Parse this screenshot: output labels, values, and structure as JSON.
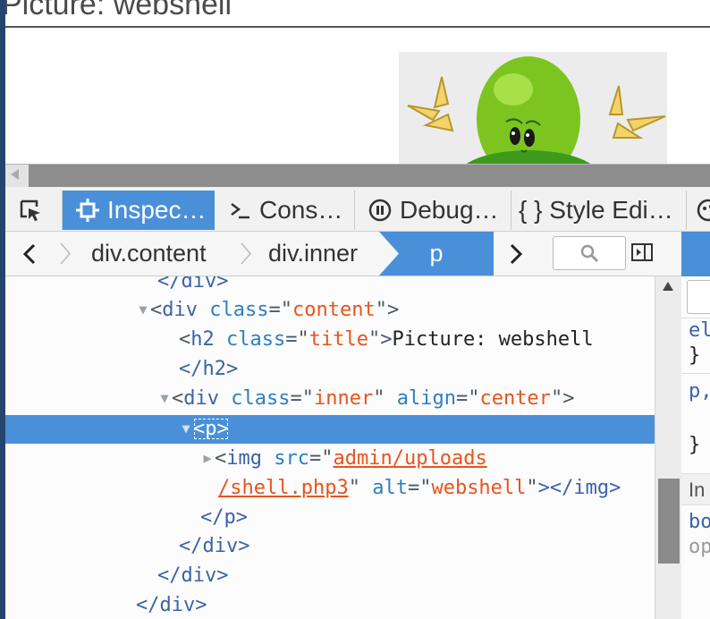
{
  "page": {
    "title": "Picture: webshell"
  },
  "devtools": {
    "tabs": [
      {
        "label": "",
        "icon": "pick-element-icon"
      },
      {
        "label": "Inspec…",
        "icon": "inspector-icon"
      },
      {
        "label": "Cons…",
        "icon": "console-icon"
      },
      {
        "label": "Debug…",
        "icon": "debugger-icon"
      },
      {
        "label": "{ } Style Edi…",
        "icon": "style-editor-icon"
      },
      {
        "label": "",
        "icon": "performance-icon"
      }
    ],
    "active_tab": "Inspector",
    "breadcrumbs": [
      "div.content",
      "div.inner",
      "p"
    ],
    "markup": [
      {
        "t": "</div>"
      },
      {
        "p1": "<",
        "tag": "div",
        "attr1": "class",
        "val1": "content",
        "p2": ">"
      },
      {
        "p1": "<",
        "tag": "h2",
        "attr1": "class",
        "val1": "title",
        "p2": ">",
        "text": "Picture: webshell"
      },
      {
        "t": "</h2>"
      },
      {
        "p1": "<",
        "tag": "div",
        "attr1": "class",
        "val1": "inner",
        "attr2": "align",
        "val2": "center",
        "p2": ">"
      },
      {
        "p1": "<",
        "tag": "p",
        "p2": ">"
      },
      {
        "p1": "<",
        "tag": "img",
        "attr1": "src",
        "val1": "admin/uploads"
      },
      {
        "val1b": "/shell.php3",
        "attr2": "alt",
        "val2": "webshell",
        "p2": "></img>"
      },
      {
        "t": "</p>"
      },
      {
        "t": "</div>"
      },
      {
        "t": "</div>"
      },
      {
        "t": "</div>"
      }
    ],
    "rules_fragments": [
      "el",
      "}",
      "p,",
      "}",
      "In",
      "bo",
      "op"
    ]
  },
  "colors": {
    "accent": "#4a90d9",
    "tag": "#3b63a8",
    "attr": "#2d7fc1",
    "value": "#e8541e"
  }
}
